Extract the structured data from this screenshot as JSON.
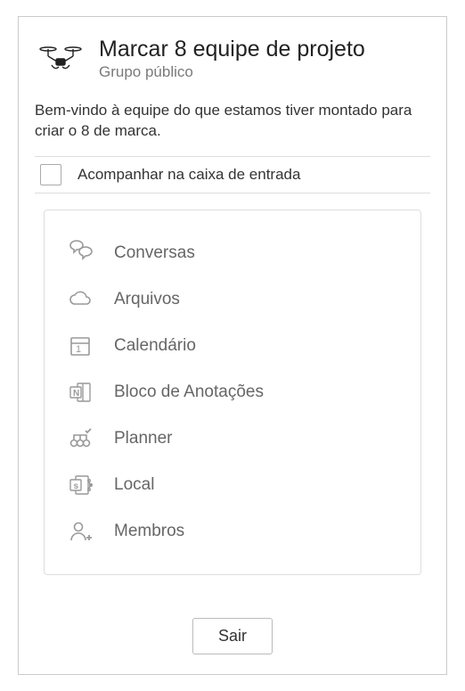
{
  "header": {
    "title": "Marcar 8 equipe de projeto",
    "subtitle": "Grupo público"
  },
  "welcome": "Bem-vindo à equipe do que estamos tiver montado para criar o 8 de marca.",
  "follow": {
    "label": "Acompanhar na caixa de entrada",
    "checked": false
  },
  "nav": {
    "items": [
      {
        "label": "Conversas",
        "icon": "chat-icon"
      },
      {
        "label": "Arquivos",
        "icon": "cloud-icon"
      },
      {
        "label": "Calendário",
        "icon": "calendar-icon"
      },
      {
        "label": "Bloco de Anotações",
        "icon": "notebook-icon"
      },
      {
        "label": "Planner",
        "icon": "planner-icon"
      },
      {
        "label": "Local",
        "icon": "site-icon"
      },
      {
        "label": "Membros",
        "icon": "members-icon"
      }
    ]
  },
  "footer": {
    "leave_label": "Sair"
  }
}
